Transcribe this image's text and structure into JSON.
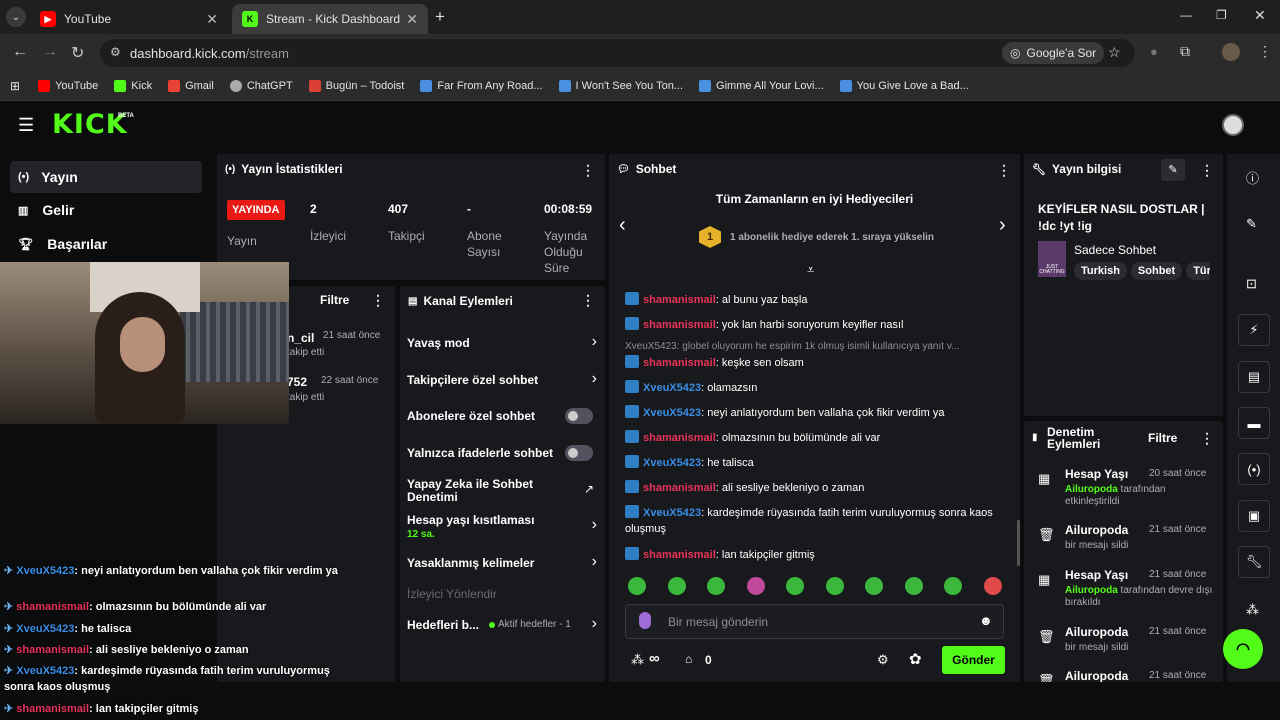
{
  "browser": {
    "tabs": [
      {
        "title": "YouTube"
      },
      {
        "title": "Stream - Kick Dashboard"
      }
    ],
    "url_host": "dashboard.kick.com",
    "url_path": "/stream",
    "google_lens": "Google'a Sor",
    "bookmarks": [
      "YouTube",
      "Kick",
      "Gmail",
      "ChatGPT",
      "Bugün – Todoist",
      "Far From Any Road...",
      "I Won't See You Ton...",
      "Gimme All Your Lovi...",
      "You Give Love a Bad..."
    ]
  },
  "kick": {
    "logo": "KICK",
    "beta": "BETA",
    "nav": [
      "Yayın",
      "Gelir",
      "Başarılar"
    ]
  },
  "stats": {
    "title": "Yayın İstatistikleri",
    "live_badge": "YAYINDA",
    "live_label": "Yayın",
    "items": [
      {
        "value": "2",
        "label": "İzleyici"
      },
      {
        "value": "407",
        "label": "Takipçi"
      },
      {
        "value": "-",
        "label": "Abone Sayısı"
      },
      {
        "value": "00:08:59",
        "label": "Yayında Olduğu Süre"
      }
    ]
  },
  "activity": {
    "filter": "Filtre",
    "rows": [
      {
        "name": "n_cil",
        "time": "21 saat önce",
        "action": "takip etti"
      },
      {
        "name": "752",
        "time": "22 saat önce",
        "action": "takip etti"
      }
    ]
  },
  "channel_actions": {
    "title": "Kanal Eylemleri",
    "slow_mode": "Yavaş mod",
    "followers_only": "Takipçilere özel sohbet",
    "subs_only": "Abonelere özel sohbet",
    "emote_only": "Yalnızca ifadelerle sohbet",
    "ai_moderation": "Yapay Zeka ile Sohbet Denetimi",
    "account_age": "Hesap yaşı kısıtlaması",
    "account_age_value": "12 sa.",
    "banned_words": "Yasaklanmış kelimeler",
    "viewer_redirect": "İzleyici Yönlendir",
    "goals": "Hedefleri b...",
    "goals_status": "Aktif hedefler - 1"
  },
  "chat": {
    "title": "Sohbet",
    "gifters_title": "Tüm Zamanların en iyi Hediyecileri",
    "gifters_badge": "1",
    "gifters_text": "1 abonelik hediye ederek 1. sıraya yükselin",
    "reply_ref": "XveuX5423: globel oluyorum he espirim 1k olmuş isimli kullanıcıya yanıt v...",
    "messages": [
      {
        "user": "shamanismail",
        "text": ": al bunu yaz başla"
      },
      {
        "user": "shamanismail",
        "text": ": yok lan harbi soruyorum keyifler nasıl"
      },
      {
        "user": "shamanismail",
        "text": ": keşke sen olsam"
      },
      {
        "user": "XveuX5423",
        "text": ": olamazsın"
      },
      {
        "user": "XveuX5423",
        "text": ": neyi anlatıyordum ben vallaha çok fikir verdim ya"
      },
      {
        "user": "shamanismail",
        "text": ": olmazsının bu bölümünde ali var"
      },
      {
        "user": "XveuX5423",
        "text": ": he talisca"
      },
      {
        "user": "shamanismail",
        "text": ": ali sesliye bekleniyo o zaman"
      },
      {
        "user": "XveuX5423",
        "text": ": kardeşimde rüyasında fatih terim vuruluyormuş sonra kaos oluşmuş"
      },
      {
        "user": "shamanismail",
        "text": ": lan takipçiler gitmiş"
      }
    ],
    "input_placeholder": "Bir mesaj gönderin",
    "points": "∞",
    "drops": "0",
    "send": "Gönder"
  },
  "stream_info": {
    "title": "Yayın bilgisi",
    "stream_title": "KEYİFLER NASIL DOSTLAR | !dc !yt !ig",
    "category": "Sadece Sohbet",
    "category_thumb_text": "JUST CHATTING",
    "tags": [
      "Turkish",
      "Sohbet",
      "Türk"
    ]
  },
  "moderation": {
    "title": "Denetim Eylemleri",
    "filter": "Filtre",
    "rows": [
      {
        "title": "Hesap Yaşı",
        "time": "20 saat önce",
        "actor": "Ailuropoda",
        "detail": " tarafından etkinleştirildi"
      },
      {
        "title": "Ailuropoda",
        "time": "21 saat önce",
        "actor": "",
        "detail": "bir mesajı sildi"
      },
      {
        "title": "Hesap Yaşı",
        "time": "21 saat önce",
        "actor": "Ailuropoda",
        "detail": " tarafından devre dışı bırakıldı"
      },
      {
        "title": "Ailuropoda",
        "time": "21 saat önce",
        "actor": "",
        "detail": "bir mesajı sildi"
      },
      {
        "title": "Ailuropoda",
        "time": "21 saat önce",
        "actor": "",
        "detail": ""
      }
    ]
  },
  "overlay_chat": [
    {
      "user": "XveuX5423",
      "text": ": neyi anlatıyordum ben vallaha çok fikir verdim ya"
    },
    {
      "user": "shamanismail",
      "text": ": olmazsının bu bölümünde ali var"
    },
    {
      "user": "XveuX5423",
      "text": ": he talisca"
    },
    {
      "user": "shamanismail",
      "text": ": ali sesliye bekleniyo o zaman"
    },
    {
      "user": "XveuX5423",
      "text": ": kardeşimde rüyasında fatih terim vuruluyormuş sonra kaos oluşmuş"
    },
    {
      "user": "shamanismail",
      "text": ": lan takipçiler gitmiş"
    }
  ],
  "colors": {
    "kick_green": "#53fc18",
    "live_red": "#e91916",
    "user_red": "#e8335a",
    "user_blue": "#3a8ee6"
  }
}
